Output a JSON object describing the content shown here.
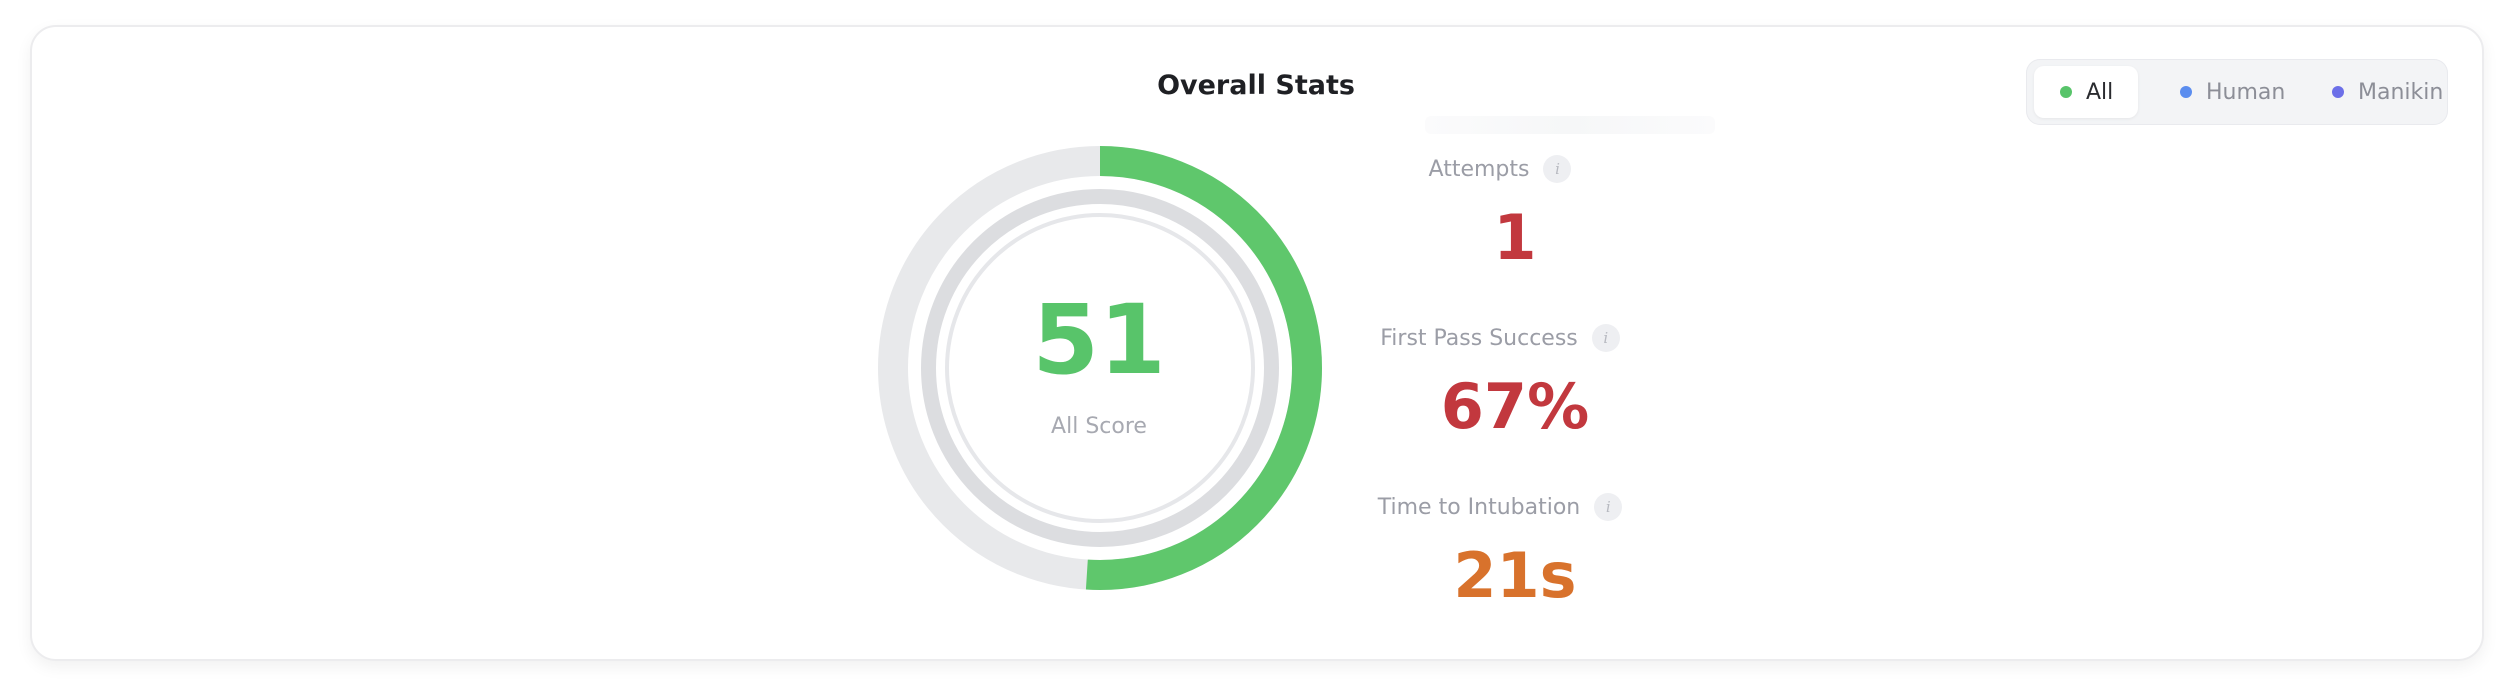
{
  "title": "Overall Stats",
  "filters": {
    "items": [
      {
        "label": "All",
        "color": "#58c46a",
        "active": true
      },
      {
        "label": "Human",
        "color": "#5b8def",
        "active": false
      },
      {
        "label": "Manikin",
        "color": "#6c6fe8",
        "active": false
      }
    ]
  },
  "score": {
    "value": "51",
    "label": "All Score",
    "percent": 51,
    "color": "#5fc76c"
  },
  "stats": [
    {
      "label": "Attempts",
      "value": "1",
      "color": "#c2383e",
      "info_icon": "info-icon"
    },
    {
      "label": "First Pass Success",
      "value": "67%",
      "color": "#c2383e",
      "info_icon": "info-icon"
    },
    {
      "label": "Time to Intubation",
      "value": "21s",
      "color": "#d8722c",
      "info_icon": "info-icon"
    }
  ]
}
